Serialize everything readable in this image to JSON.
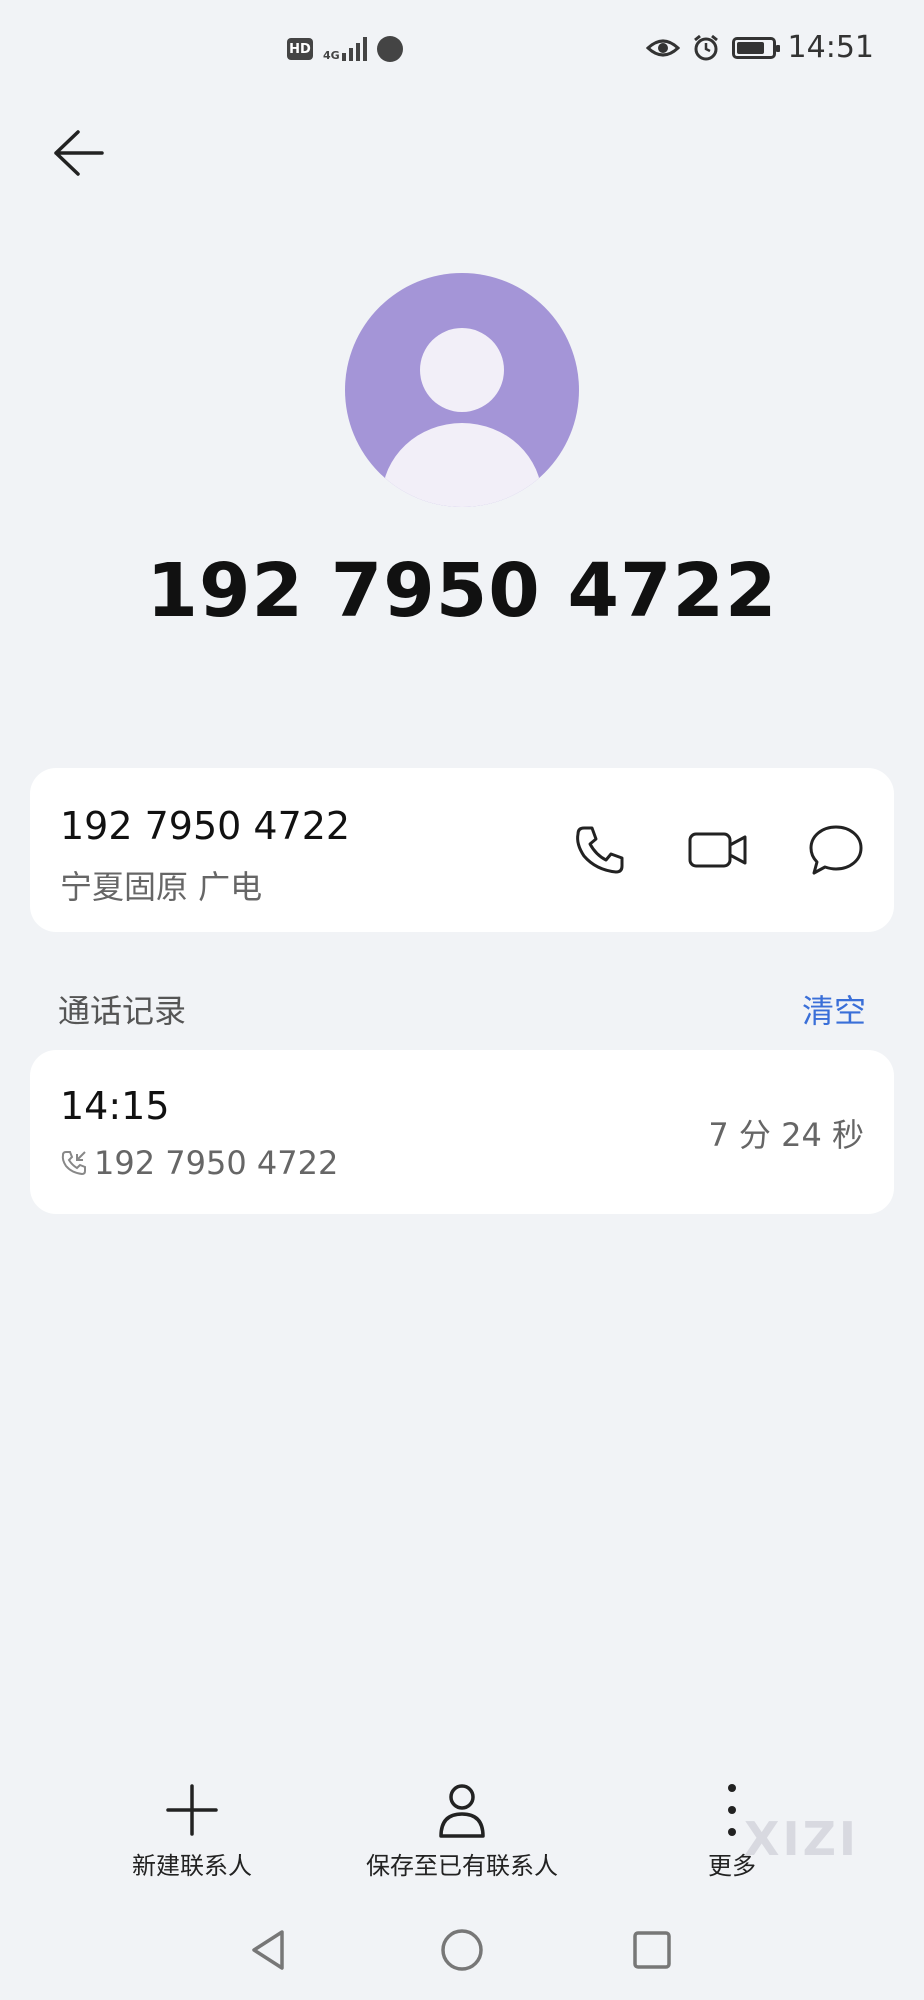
{
  "status_bar": {
    "hd": "HD",
    "network": "4G",
    "time": "14:51",
    "icons": [
      "hd-icon",
      "signal-icon",
      "voice-icon",
      "eye-icon",
      "alarm-icon",
      "battery-icon"
    ]
  },
  "contact": {
    "number_display": "192 7950 4722",
    "number": "192 7950 4722",
    "location": "宁夏固原 广电",
    "avatar_color": "#a495d7"
  },
  "call_log": {
    "title": "通话记录",
    "clear_label": "清空",
    "entries": [
      {
        "time": "14:15",
        "number": "192 7950 4722",
        "duration": "7 分 24 秒"
      }
    ]
  },
  "bottom_actions": {
    "new_contact": "新建联系人",
    "save_existing": "保存至已有联系人",
    "more": "更多"
  },
  "watermark": "XIZI",
  "accent_color": "#3a6fd8"
}
